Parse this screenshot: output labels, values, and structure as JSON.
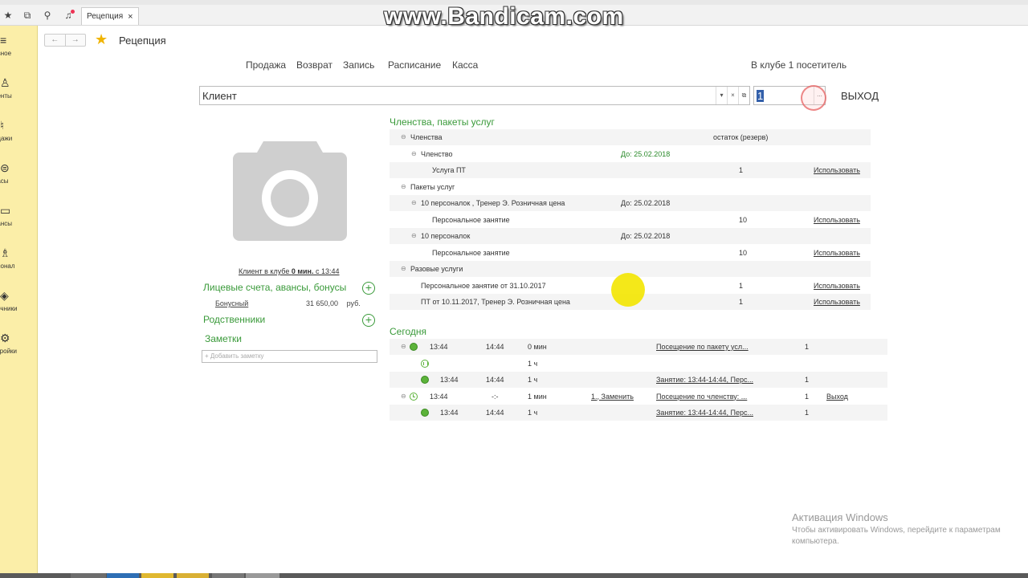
{
  "watermark": "www.Bandicam.com",
  "tab": {
    "title": "Рецепция",
    "close": "×"
  },
  "toolbar_icons": [
    "star-icon",
    "history-icon",
    "search-icon",
    "bell-icon"
  ],
  "sidebar": {
    "items": [
      {
        "label": "авное",
        "icon": "menu-icon"
      },
      {
        "label": "иенты",
        "icon": "clients-icon"
      },
      {
        "label": "одажи",
        "icon": "sales-icon"
      },
      {
        "label": "пасы",
        "icon": "stock-icon"
      },
      {
        "label": "нансы",
        "icon": "wallet-icon"
      },
      {
        "label": "рсонал",
        "icon": "staff-icon"
      },
      {
        "label": "вочники",
        "icon": "catalogs-icon"
      },
      {
        "label": "стройки",
        "icon": "settings-icon"
      }
    ]
  },
  "nav": {
    "back": "←",
    "forward": "→"
  },
  "page_title": "Рецепция",
  "menu": [
    "Продажа",
    "Возврат",
    "Запись",
    "Расписание",
    "Касса"
  ],
  "visitors_text": "В клубе 1 посетитель",
  "client_field": {
    "value": "Клиент",
    "btn1": "▾",
    "btn2": "×",
    "btn3": "⧉"
  },
  "number_field": {
    "value": "1",
    "dots": "..."
  },
  "exit_label": "ВЫХОД",
  "client_time": {
    "prefix": "Клиент в клубе ",
    "bold": "0 мин.",
    "suffix": " с 13:44"
  },
  "accounts": {
    "title": "Лицевые счета, авансы, бонусы",
    "name": "Бонусный",
    "value": "31 650,00",
    "currency": "руб."
  },
  "relatives_title": "Родственники",
  "notes": {
    "title": "Заметки",
    "placeholder": "+ Добавить заметку"
  },
  "membership": {
    "title": "Членства, пакеты услуг",
    "header_col": "остаток (резерв)",
    "rows": [
      {
        "name": "Членства",
        "date": "",
        "qty": "",
        "action": "",
        "level": 0,
        "toggle": "⊖"
      },
      {
        "name": "Членство",
        "date": "До: 25.02.2018",
        "qty": "",
        "action": "",
        "level": 1,
        "toggle": "⊖",
        "green": true
      },
      {
        "name": "Услуга ПТ",
        "date": "",
        "qty": "1",
        "action": "Использовать",
        "level": 2,
        "toggle": ""
      },
      {
        "name": "Пакеты услуг",
        "date": "",
        "qty": "",
        "action": "",
        "level": 0,
        "toggle": "⊖"
      },
      {
        "name": "10 персоналок , Тренер Э. Розничная цена",
        "date": "До: 25.02.2018",
        "qty": "",
        "action": "",
        "level": 1,
        "toggle": "⊖"
      },
      {
        "name": "Персональное занятие",
        "date": "",
        "qty": "10",
        "action": "Использовать",
        "level": 2,
        "toggle": ""
      },
      {
        "name": "10 персоналок",
        "date": "До: 25.02.2018",
        "qty": "",
        "action": "",
        "level": 1,
        "toggle": "⊖"
      },
      {
        "name": "Персональное занятие",
        "date": "",
        "qty": "10",
        "action": "Использовать",
        "level": 2,
        "toggle": ""
      },
      {
        "name": "Разовые услуги",
        "date": "",
        "qty": "",
        "action": "",
        "level": 0,
        "toggle": "⊖"
      },
      {
        "name": "Персональное занятие от 31.10.2017",
        "date": "",
        "qty": "1",
        "action": "Использовать",
        "level": 1,
        "toggle": ""
      },
      {
        "name": "ПТ от 10.11.2017, Тренер Э. Розничная цена",
        "date": "",
        "qty": "1",
        "action": "Использовать",
        "level": 1,
        "toggle": ""
      }
    ]
  },
  "today": {
    "title": "Сегодня",
    "rows": [
      {
        "toggle": "⊖",
        "status": "active",
        "start": "13:44",
        "end": "14:44",
        "dur": "0 мин",
        "extra": "",
        "desc": "Посещение по пакету усл...",
        "qty": "1",
        "action": "",
        "indent": 0
      },
      {
        "toggle": "",
        "status": "pause",
        "start": "",
        "end": "",
        "dur": "1 ч",
        "extra": "",
        "desc": "",
        "qty": "",
        "action": "",
        "indent": 1
      },
      {
        "toggle": "",
        "status": "active",
        "start": "13:44",
        "end": "14:44",
        "dur": "1 ч",
        "extra": "",
        "desc": "Занятие: 13:44-14:44, Перс...",
        "qty": "1",
        "action": "",
        "indent": 1
      },
      {
        "toggle": "⊖",
        "status": "clock",
        "start": "13:44",
        "end": "-:-",
        "dur": "1 мин",
        "extra": "1., Заменить",
        "desc": "Посещение по членству: ...",
        "qty": "1",
        "action": "Выход",
        "indent": 0
      },
      {
        "toggle": "",
        "status": "active",
        "start": "13:44",
        "end": "14:44",
        "dur": "1 ч",
        "extra": "",
        "desc": "Занятие: 13:44-14:44, Перс...",
        "qty": "1",
        "action": "",
        "indent": 1
      }
    ]
  },
  "activation": {
    "title": "Активация Windows",
    "line1": "Чтобы активировать Windows, перейдите к параметрам",
    "line2": "компьютера."
  }
}
